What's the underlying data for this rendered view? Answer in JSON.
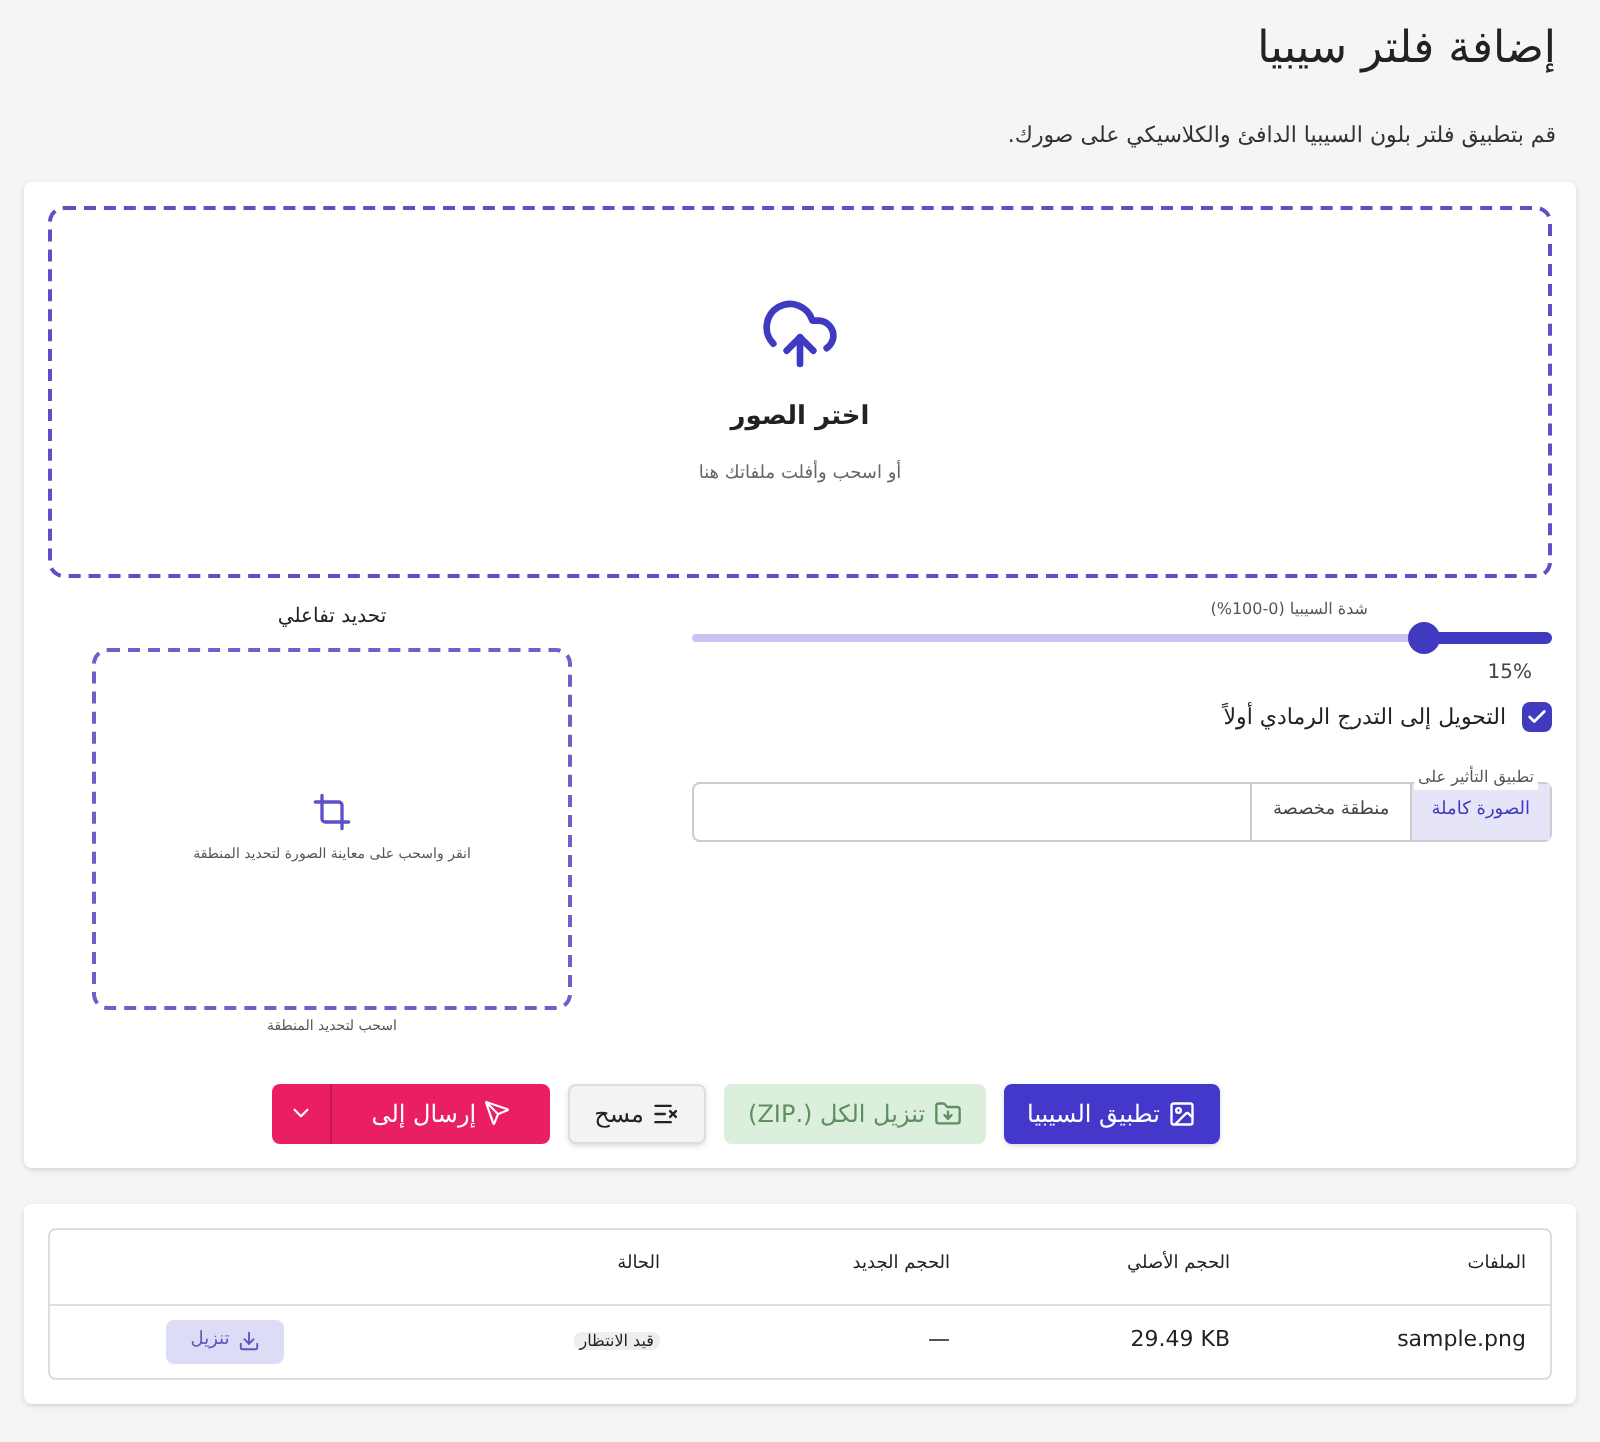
{
  "page": {
    "title": "إضافة فلتر سيبيا",
    "description": "قم بتطبيق فلتر بلون السيبيا الدافئ والكلاسيكي على صورك."
  },
  "dropzone": {
    "title": "اختر الصور",
    "hint": "أو اسحب وأفلت ملفاتك هنا"
  },
  "intensity": {
    "label": "شدة السيبيا (0-100%)",
    "level": 0.15,
    "reading": "15%"
  },
  "grayscale": {
    "label": "التحويل إلى التدرج الرمادي أولاً",
    "checked": true
  },
  "apply_to": {
    "label": "تطبيق التأثير على",
    "options": [
      {
        "label": "الصورة كاملة",
        "selected": true
      },
      {
        "label": "منطقة مخصصة",
        "selected": false
      }
    ]
  },
  "crop": {
    "title": "تحديد تفاعلي",
    "hint": "انقر واسحب على معاينة الصورة لتحديد المنطقة",
    "caption": "اسحب لتحديد المنطقة"
  },
  "actions": [
    {
      "kind": "primary",
      "label": "تطبيق السيبيا",
      "disabled": false
    },
    {
      "kind": "download",
      "label": "تنزيل الكل (.ZIP)",
      "disabled": true
    },
    {
      "kind": "clear",
      "label": "مسح",
      "disabled": false
    },
    {
      "kind": "send",
      "label": "إرسال إلى",
      "disabled": false
    }
  ],
  "table": {
    "columns": [
      "الملفات",
      "الحجم الأصلي",
      "الحجم الجديد",
      "الحالة"
    ],
    "rows": [
      {
        "file": "sample.png",
        "original": "29.49 KB",
        "new": "—",
        "status": "قيد الانتظار",
        "download": {
          "label": "تنزيل",
          "disabled": true
        }
      }
    ]
  }
}
